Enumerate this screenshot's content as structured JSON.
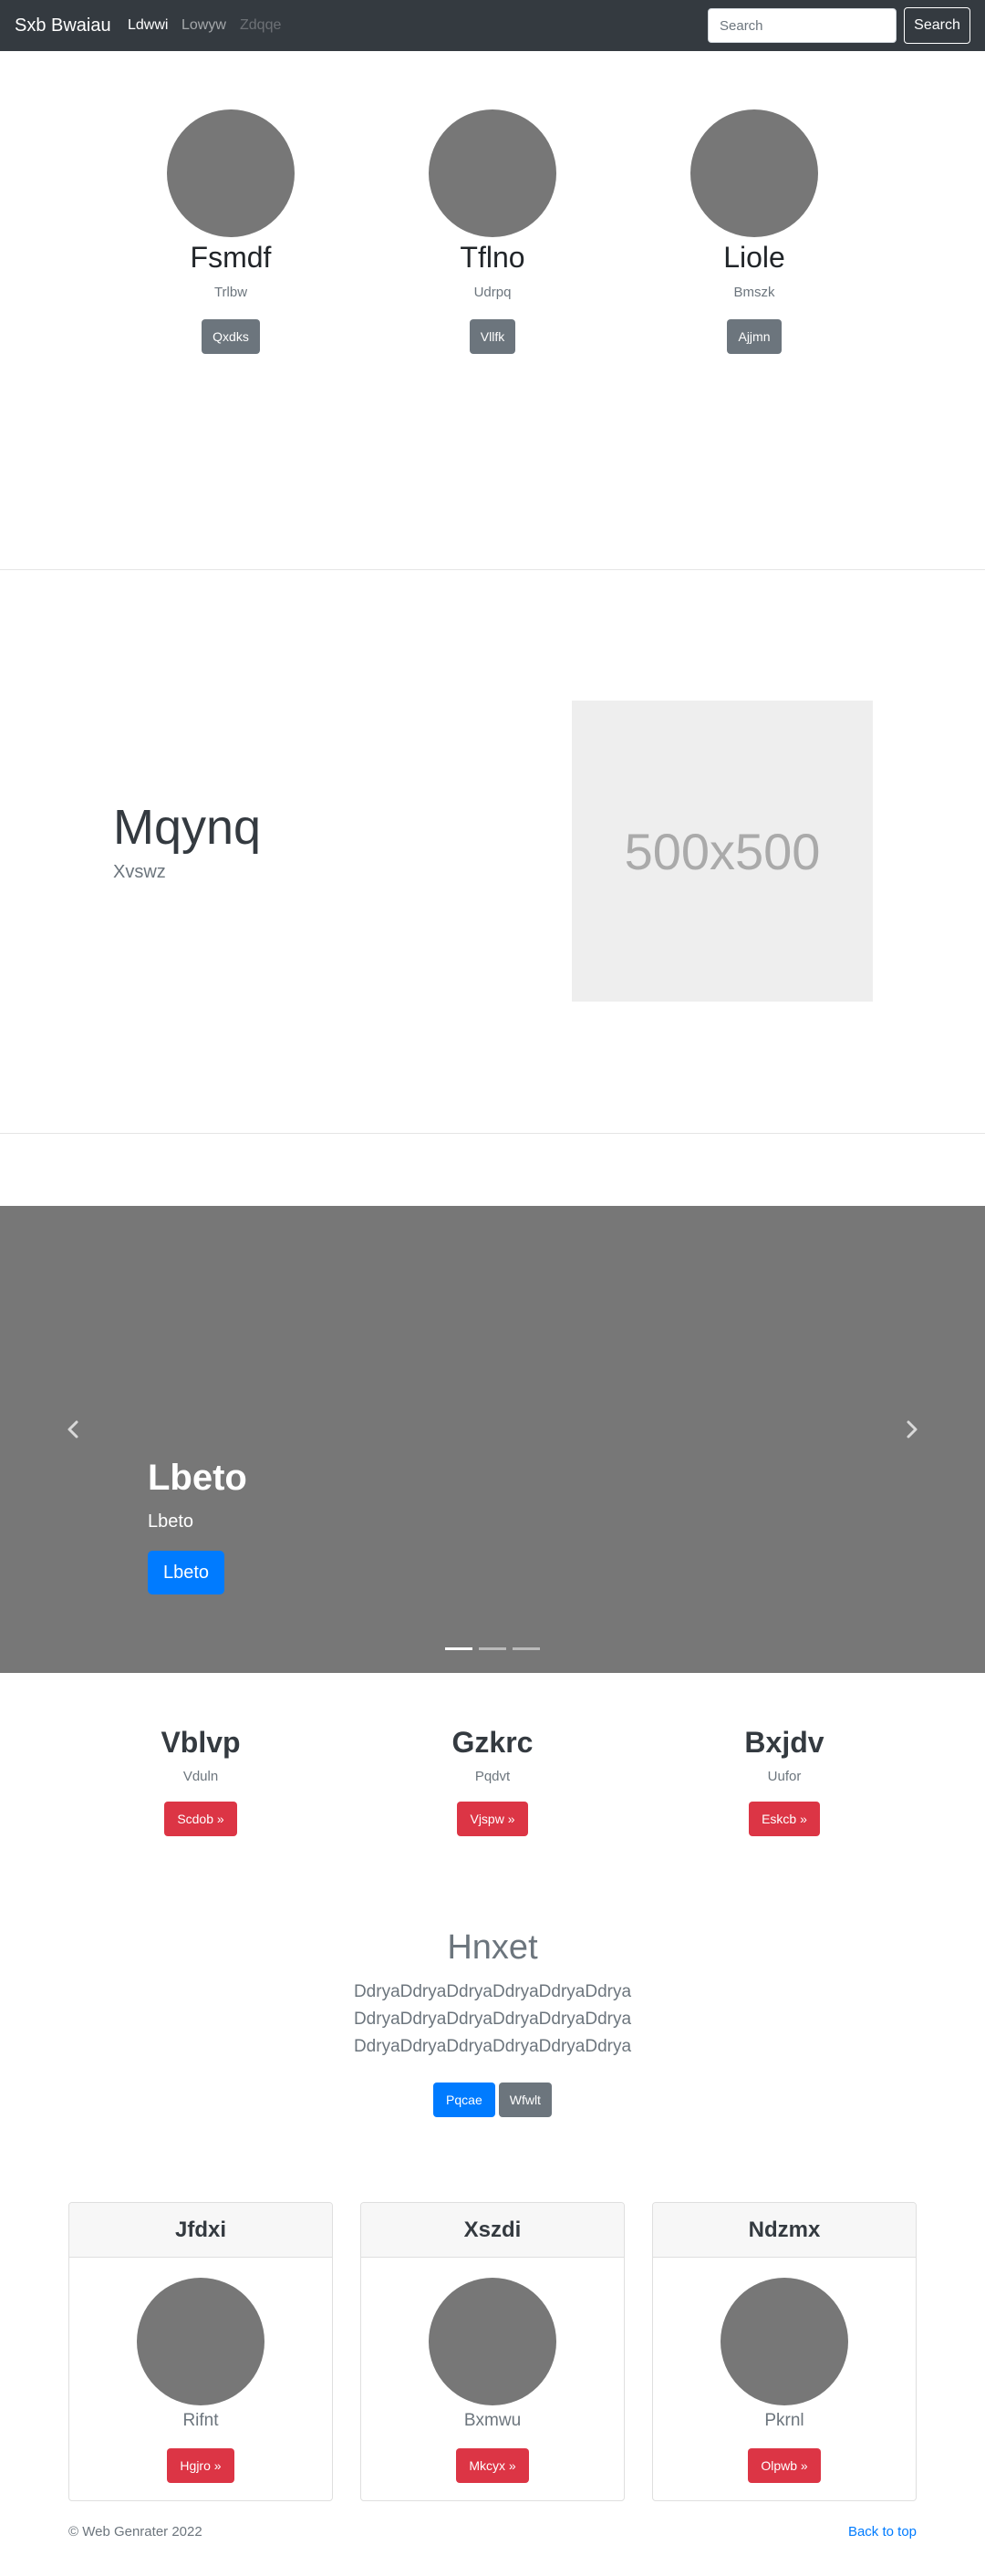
{
  "navbar": {
    "brand": "Sxb Bwaiau",
    "links": [
      "Ldwwi",
      "Lowyw",
      "Zdqqe"
    ],
    "search_placeholder": "Search",
    "search_button": "Search"
  },
  "team": [
    {
      "name": "Fsmdf",
      "subtitle": "Trlbw",
      "button": "Qxdks"
    },
    {
      "name": "Tflno",
      "subtitle": "Udrpq",
      "button": "Vllfk"
    },
    {
      "name": "Liole",
      "subtitle": "Bmszk",
      "button": "Ajjmn"
    }
  ],
  "feature": {
    "heading": "Mqynq",
    "subtitle": "Xvswz",
    "placeholder_label": "500x500"
  },
  "carousel": {
    "heading": "Lbeto",
    "subtitle": "Lbeto",
    "button": "Lbeto",
    "slide_count": 3,
    "active_slide": 1
  },
  "marketing": [
    {
      "title": "Vblvp",
      "subtitle": "Vduln",
      "button": "Scdob »"
    },
    {
      "title": "Gzkrc",
      "subtitle": "Pqdvt",
      "button": "Vjspw »"
    },
    {
      "title": "Bxjdv",
      "subtitle": "Uufor",
      "button": "Eskcb »"
    }
  ],
  "hero": {
    "title": "Hnxet",
    "lines": [
      "DdryaDdryaDdryaDdryaDdryaDdrya",
      "DdryaDdryaDdryaDdryaDdryaDdrya",
      "DdryaDdryaDdryaDdryaDdryaDdrya"
    ],
    "primary_button": "Pqcae",
    "secondary_button": "Wfwlt"
  },
  "cards": [
    {
      "header": "Jfdxi",
      "subtitle": "Rifnt",
      "button": "Hgjro »"
    },
    {
      "header": "Xszdi",
      "subtitle": "Bxmwu",
      "button": "Mkcyx »"
    },
    {
      "header": "Ndzmx",
      "subtitle": "Pkrnl",
      "button": "Olpwb »"
    }
  ],
  "footer": {
    "copyright": "© Web Genrater 2022",
    "back_to_top": "Back to top"
  },
  "colors": {
    "navbar_bg": "#343a40",
    "primary": "#007bff",
    "secondary": "#6c757d",
    "danger": "#dc3545",
    "placeholder_gray": "#777777"
  }
}
